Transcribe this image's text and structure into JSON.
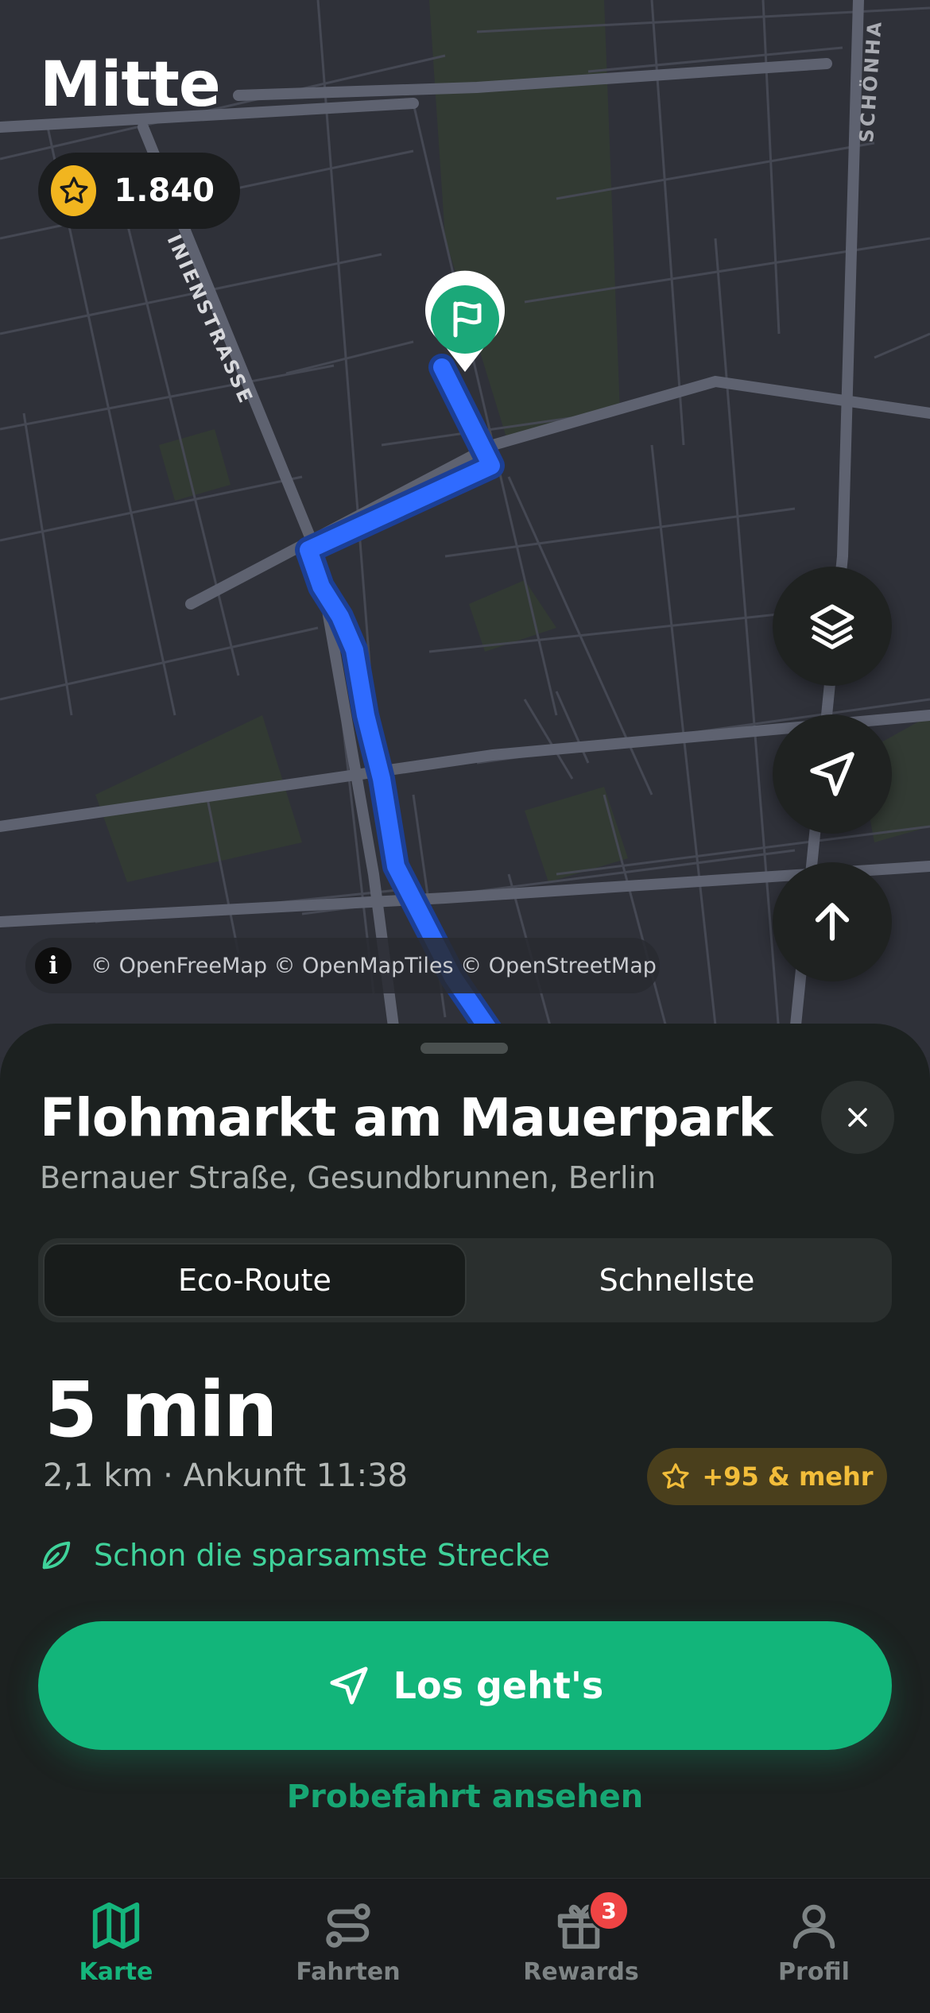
{
  "header": {
    "area_title": "Mitte",
    "points": "1.840"
  },
  "map": {
    "street_labels": [
      "INIENSTRASSE",
      "SCHÖNHA"
    ],
    "attribution": "© OpenFreeMap © OpenMapTiles © OpenStreetMap",
    "controls": [
      "layers-icon",
      "locate-icon",
      "north-arrow-icon"
    ],
    "route_color": "#2f6bff"
  },
  "destination": {
    "name": "Flohmarkt am Mauerpark",
    "address": "Bernauer Straße, Gesundbrunnen, Berlin"
  },
  "route_options": {
    "eco": "Eco-Route",
    "fastest": "Schnellste",
    "selected": "Eco-Route"
  },
  "trip": {
    "duration": "5 min",
    "meta": "2,1 km · Ankunft 11:38",
    "reward": "+95 & mehr",
    "eco_hint": "Schon die sparsamste Strecke"
  },
  "actions": {
    "go": "Los geht's",
    "preview": "Probefahrt ansehen"
  },
  "tabbar": {
    "items": [
      {
        "label": "Karte",
        "icon": "map-icon",
        "active": true
      },
      {
        "label": "Fahrten",
        "icon": "routes-icon",
        "active": false
      },
      {
        "label": "Rewards",
        "icon": "gift-icon",
        "active": false,
        "badge": "3"
      },
      {
        "label": "Profil",
        "icon": "user-icon",
        "active": false
      }
    ]
  },
  "colors": {
    "accent": "#12b57a",
    "sheet": "#1c2120",
    "reward": "#f2bd3a",
    "badge": "#ef4444"
  }
}
